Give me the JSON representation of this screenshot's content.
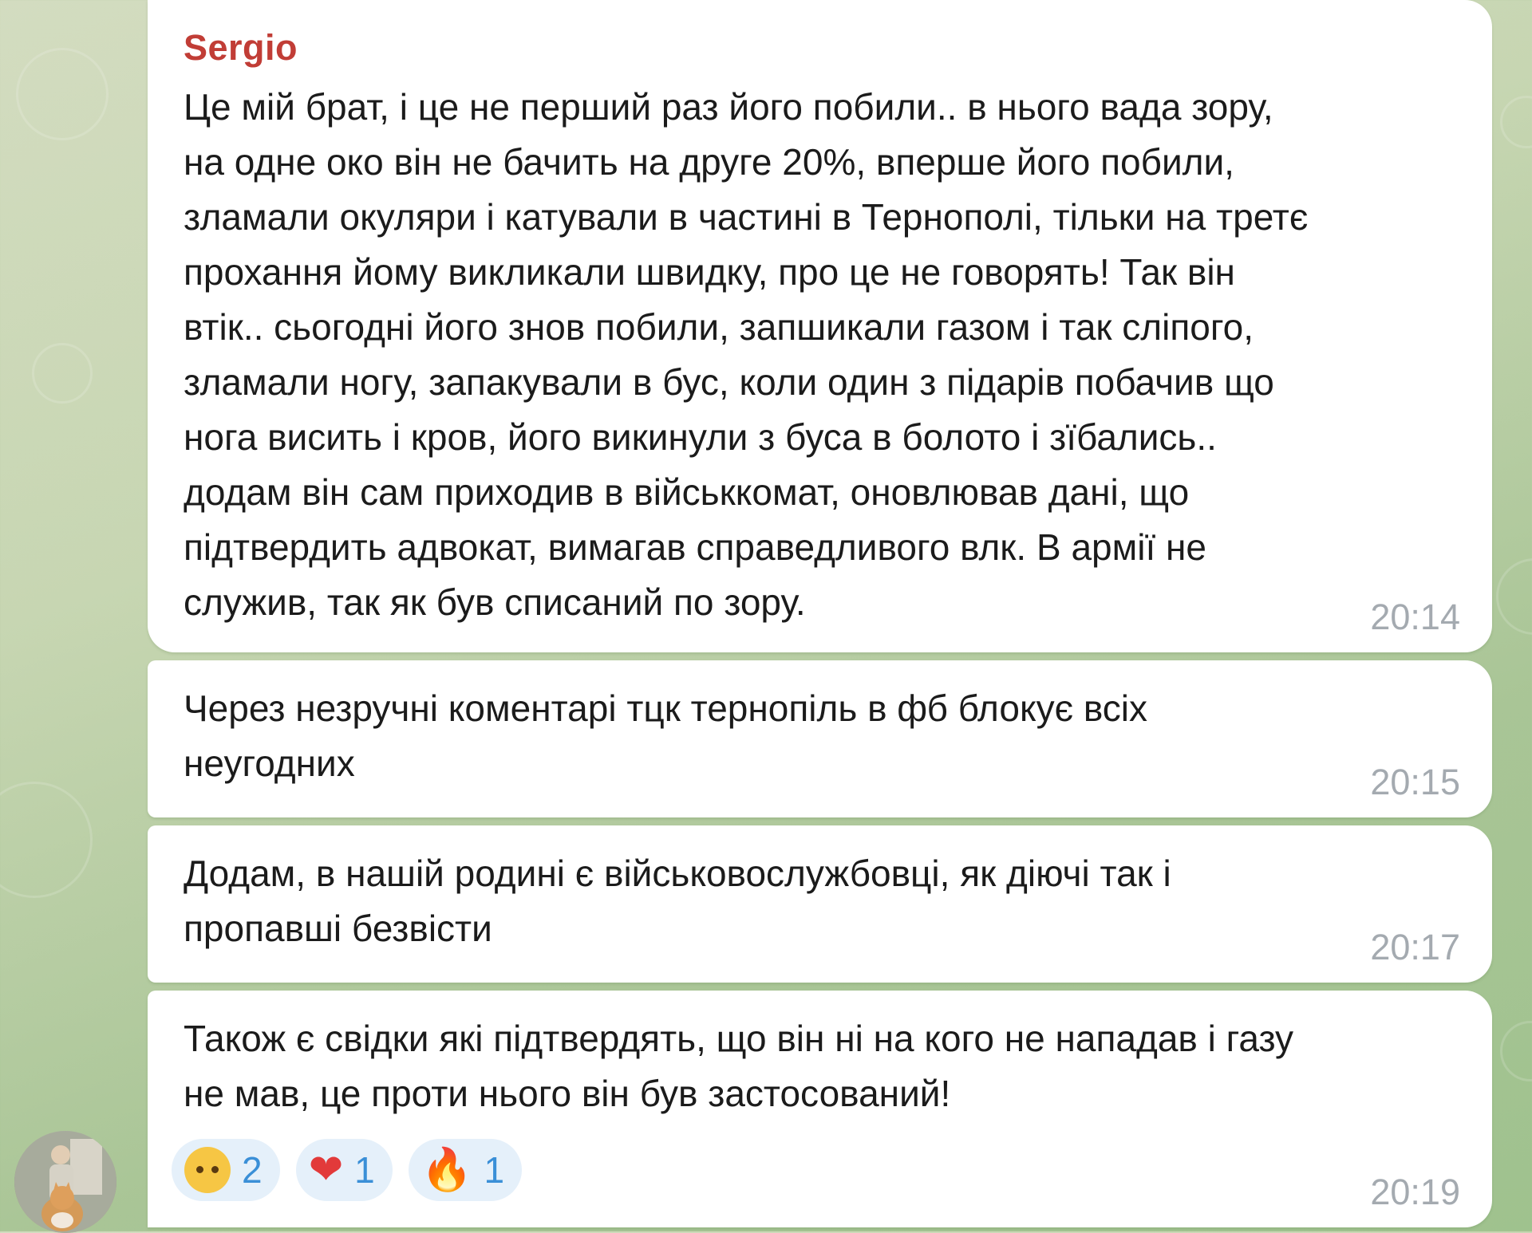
{
  "chat": {
    "messages": [
      {
        "sender": "Sergio",
        "text": "Це мій брат, і це не перший раз його побили.. в нього вада зору,\nна одне око він не бачить на друге 20%, вперше його побили,\nзламали окуляри і катували в частині в Тернополі, тільки на третє\nпрохання йому викликали швидку, про це не говорять! Так він\nвтік.. сьогодні його знов побили, запшикали газом і так сліпого,\nзламали ногу, запакували в бус, коли один з підарів побачив що\nнога висить і кров, його викинули з буса в болото і зїбались..\nдодам він сам приходив в військкомат, оновлював дані, що\nпідтвердить адвокат, вимагав справедливого влк. В армії не\nслужив, так як був списаний по зору.",
        "time": "20:14"
      },
      {
        "text": "Через незручні коментарі тцк тернопіль в фб блокує всіх\nнеугодних",
        "time": "20:15"
      },
      {
        "text": "Додам, в нашій родині є військовослужбовці, як діючі так і\nпропавші безвісти",
        "time": "20:17"
      },
      {
        "text": "Також є свідки які підтвердять, що він ні на кого не нападав і газу\nне мав, це проти нього він був застосований!",
        "time": "20:19",
        "reactions": [
          {
            "emoji": "exploding-head",
            "count": "2"
          },
          {
            "emoji": "red-heart",
            "count": "1"
          },
          {
            "emoji": "fire",
            "count": "1"
          }
        ]
      }
    ]
  },
  "colors": {
    "sender_name": "#c13d36",
    "reaction_count": "#3a8fd7",
    "timestamp": "#a4aab0",
    "bubble": "#ffffff"
  }
}
